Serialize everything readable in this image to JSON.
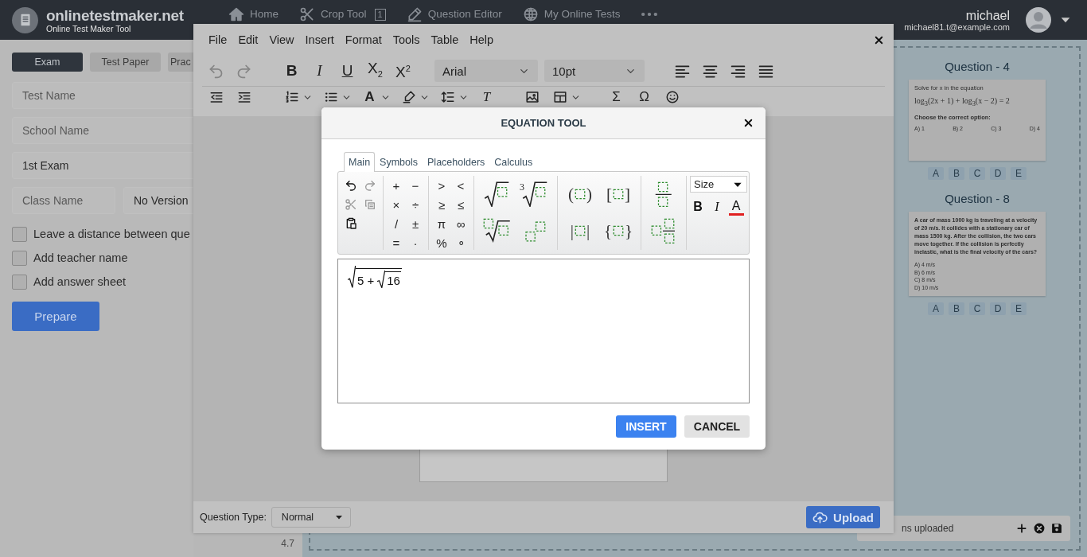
{
  "header": {
    "brand": "onlinetestmaker.net",
    "tagline": "Online Test Maker Tool",
    "nav": [
      {
        "kind": "home",
        "label": "Home"
      },
      {
        "kind": "crop",
        "label": "Crop Tool",
        "badge": "1"
      },
      {
        "kind": "editor",
        "label": "Question Editor"
      },
      {
        "kind": "globe",
        "label": "My Online Tests"
      },
      {
        "kind": "more"
      }
    ],
    "user": {
      "name": "michael",
      "email": "michael81.t@example.com"
    }
  },
  "sidebar": {
    "tabs": [
      {
        "label": "Exam",
        "selected": true
      },
      {
        "label": "Test Paper",
        "selected": false
      },
      {
        "label": "Prac",
        "selected": false
      }
    ],
    "fields": [
      {
        "placeholder": "Test Name"
      },
      {
        "placeholder": "School Name"
      },
      {
        "value": "1st Exam"
      }
    ],
    "class_field": {
      "placeholder": "Class Name"
    },
    "version_select": {
      "value": "No Version"
    },
    "options": [
      {
        "label": "Leave a distance between que",
        "checked": false
      },
      {
        "label": "Add teacher name",
        "checked": false
      },
      {
        "label": "Add answer sheet",
        "checked": false
      }
    ],
    "prepare_button": "Prepare"
  },
  "page_number": "4.7",
  "questions": [
    {
      "title": "Question - 4",
      "kind": "inline-options",
      "text": "Solve for x in the equation",
      "equation": "log$_{3}$(2x + 1) + log$_{3}$(x − 2) = 2",
      "prompt": "Choose the correct option:",
      "options": [
        "A) 1",
        "B) 2",
        "C) 3",
        "D) 4"
      ],
      "answers": [
        "A",
        "B",
        "C",
        "D",
        "E"
      ]
    },
    {
      "title": "Question - 8",
      "kind": "list-options",
      "text": "A car of mass 1000 kg is traveling at a velocity of 20 m/s. It collides with a stationary car of mass 1500 kg. After the collision, the two cars move together. If the collision is perfectly inelastic, what is the final velocity of the cars?",
      "options": [
        "A) 4 m/s",
        "B) 6 m/s",
        "C) 8 m/s",
        "D) 10 m/s"
      ],
      "answers": [
        "A",
        "B",
        "C",
        "D",
        "E"
      ]
    }
  ],
  "upload_bar": {
    "status": "ns uploaded"
  },
  "editor": {
    "menu": [
      "File",
      "Edit",
      "View",
      "Insert",
      "Format",
      "Tools",
      "Table",
      "Help"
    ],
    "toolbar_rows": [
      {
        "groups": [
          [
            {
              "kind": "undo",
              "disabled": true
            },
            {
              "kind": "redo",
              "disabled": true
            }
          ],
          [
            {
              "kind": "bold",
              "text": "B"
            },
            {
              "kind": "italic",
              "text": "I"
            },
            {
              "kind": "underline",
              "text": "U"
            },
            {
              "kind": "subscript",
              "text": "X$_{2}$"
            },
            {
              "kind": "superscript",
              "text": "X$^{2}$"
            }
          ],
          [
            {
              "kind": "font-select",
              "text": "Arial"
            },
            {
              "kind": "size-select",
              "text": "10pt"
            }
          ],
          [
            {
              "kind": "align-left"
            },
            {
              "kind": "align-center"
            },
            {
              "kind": "align-right"
            },
            {
              "kind": "justify"
            }
          ]
        ]
      },
      {
        "groups": [
          [
            {
              "kind": "outdent"
            },
            {
              "kind": "indent"
            }
          ],
          [
            {
              "kind": "numbered-list",
              "caret": true
            },
            {
              "kind": "bullet-list",
              "caret": true
            },
            {
              "kind": "text-color",
              "text": "A",
              "caret": true
            },
            {
              "kind": "highlight",
              "caret": true
            },
            {
              "kind": "line-height",
              "caret": true
            },
            {
              "kind": "clear-format",
              "text": "T"
            }
          ],
          [
            {
              "kind": "image"
            },
            {
              "kind": "table",
              "caret": true
            }
          ],
          [
            {
              "kind": "symbol",
              "text": "Σ"
            },
            {
              "kind": "symbol",
              "text": "Ω"
            },
            {
              "kind": "emoji"
            }
          ]
        ]
      }
    ],
    "question_type_label": "Question Type:",
    "question_type": "Normal",
    "upload_button": "Upload"
  },
  "equation_tool": {
    "title": "EQUATION TOOL",
    "tabs": [
      {
        "label": "Main",
        "selected": true
      },
      {
        "label": "Symbols",
        "selected": false
      },
      {
        "label": "Placeholders",
        "selected": false
      },
      {
        "label": "Calculus",
        "selected": false
      }
    ],
    "groups": [
      {
        "kind": "small-grid",
        "items": [
          {
            "kind": "undo",
            "disabled": false
          },
          {
            "kind": "redo",
            "disabled": true
          },
          {
            "kind": "cut",
            "disabled": true
          },
          {
            "kind": "copy",
            "disabled": true
          },
          {
            "kind": "paste",
            "disabled": false
          }
        ]
      },
      {
        "kind": "small-grid",
        "items": [
          {
            "kind": "symbol",
            "text": "+"
          },
          {
            "kind": "symbol",
            "text": "−"
          },
          {
            "kind": "symbol",
            "text": "×"
          },
          {
            "kind": "symbol",
            "text": "÷"
          },
          {
            "kind": "symbol",
            "text": "/"
          },
          {
            "kind": "symbol",
            "text": "±"
          },
          {
            "kind": "symbol",
            "text": "="
          },
          {
            "kind": "symbol",
            "text": "·"
          }
        ]
      },
      {
        "kind": "small-grid",
        "items": [
          {
            "kind": "symbol",
            "text": ">"
          },
          {
            "kind": "symbol",
            "text": "<"
          },
          {
            "kind": "symbol",
            "text": "≥"
          },
          {
            "kind": "symbol",
            "text": "≤"
          },
          {
            "kind": "symbol",
            "text": "π"
          },
          {
            "kind": "symbol",
            "text": "∞"
          },
          {
            "kind": "symbol",
            "text": "%"
          },
          {
            "kind": "symbol",
            "text": "∘"
          }
        ]
      },
      {
        "kind": "large-grid",
        "items": [
          {
            "kind": "sqrt"
          },
          {
            "kind": "root",
            "index": "3"
          },
          {
            "kind": "nth-root"
          },
          {
            "kind": "power"
          }
        ]
      },
      {
        "kind": "large-grid",
        "items": [
          {
            "kind": "wrap",
            "open": "(",
            "close": ")"
          },
          {
            "kind": "wrap",
            "open": "[",
            "close": "]"
          },
          {
            "kind": "wrap",
            "open": "|",
            "close": "|"
          },
          {
            "kind": "wrap",
            "open": "{",
            "close": "}"
          }
        ]
      },
      {
        "kind": "stack",
        "items": [
          {
            "kind": "fraction"
          },
          {
            "kind": "mixed-fraction"
          }
        ]
      }
    ],
    "size_select": "Size",
    "format_buttons": [
      {
        "kind": "bold",
        "text": "B"
      },
      {
        "kind": "italic",
        "text": "I"
      },
      {
        "kind": "color",
        "text": "A",
        "color": "#e02020"
      }
    ],
    "expression": [
      {
        "kind": "sqrt",
        "content": [
          {
            "kind": "text",
            "text": "5 +"
          },
          {
            "kind": "sqrt",
            "content": [
              {
                "kind": "text",
                "text": "16"
              }
            ]
          }
        ]
      }
    ],
    "buttons": [
      {
        "kind": "primary",
        "label": "INSERT"
      },
      {
        "kind": "secondary",
        "label": "CANCEL"
      }
    ]
  }
}
